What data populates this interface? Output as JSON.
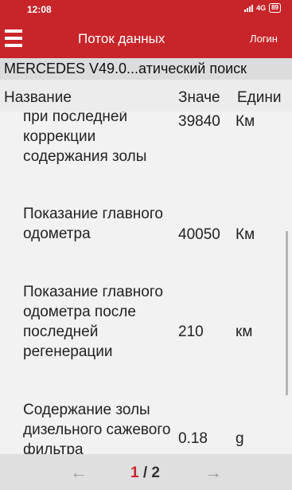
{
  "status": {
    "time": "12:08",
    "network": "4G",
    "battery": "89"
  },
  "appbar": {
    "title": "Поток данных",
    "login": "Логин"
  },
  "subheader": {
    "text": "MERCEDES V49.0...атический поиск"
  },
  "columns": {
    "name": "Название",
    "value": "Значе",
    "unit": "Едини"
  },
  "rows": [
    {
      "name": "при последней коррекции содержания золы",
      "value": "39840",
      "unit": "Км"
    },
    {
      "name": "Показание главного одометра",
      "value": "40050",
      "unit": "Км"
    },
    {
      "name": "Показание главного одометра после последней регенерации",
      "value": "210",
      "unit": "км"
    },
    {
      "name": "Содержание золы дизельного сажевого фильтра",
      "value": "0.18",
      "unit": "g"
    }
  ],
  "pagination": {
    "current": "1",
    "separator": "/",
    "total": "2"
  },
  "colors": {
    "primary": "#c8252b"
  }
}
